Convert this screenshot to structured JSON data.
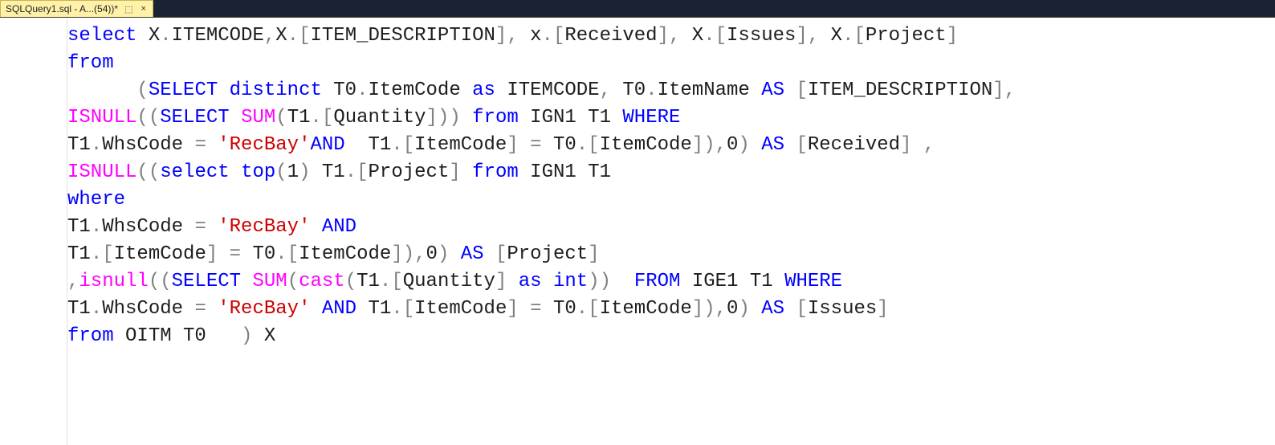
{
  "tab": {
    "title": "SQLQuery1.sql - A...(54))*",
    "pin_glyph": "⬚",
    "close_glyph": "×"
  },
  "code": {
    "tokens": [
      [
        [
          "kw",
          "select"
        ],
        [
          "id",
          " X"
        ],
        [
          "op",
          "."
        ],
        [
          "id",
          "ITEMCODE"
        ],
        [
          "op",
          ","
        ],
        [
          "id",
          "X"
        ],
        [
          "op",
          "."
        ],
        [
          "op",
          "["
        ],
        [
          "id",
          "ITEM_DESCRIPTION"
        ],
        [
          "op",
          "]"
        ],
        [
          "op",
          ","
        ],
        [
          "id",
          " x"
        ],
        [
          "op",
          "."
        ],
        [
          "op",
          "["
        ],
        [
          "id",
          "Received"
        ],
        [
          "op",
          "]"
        ],
        [
          "op",
          ","
        ],
        [
          "id",
          " X"
        ],
        [
          "op",
          "."
        ],
        [
          "op",
          "["
        ],
        [
          "id",
          "Issues"
        ],
        [
          "op",
          "]"
        ],
        [
          "op",
          ","
        ],
        [
          "id",
          " X"
        ],
        [
          "op",
          "."
        ],
        [
          "op",
          "["
        ],
        [
          "id",
          "Project"
        ],
        [
          "op",
          "]"
        ]
      ],
      [
        [
          "kw",
          "from"
        ]
      ],
      [
        [
          "id",
          "      "
        ],
        [
          "op",
          "("
        ],
        [
          "kw",
          "SELECT"
        ],
        [
          "id",
          " "
        ],
        [
          "kw",
          "distinct"
        ],
        [
          "id",
          " T0"
        ],
        [
          "op",
          "."
        ],
        [
          "id",
          "ItemCode "
        ],
        [
          "kw",
          "as"
        ],
        [
          "id",
          " ITEMCODE"
        ],
        [
          "op",
          ","
        ],
        [
          "id",
          " T0"
        ],
        [
          "op",
          "."
        ],
        [
          "id",
          "ItemName "
        ],
        [
          "kw",
          "AS"
        ],
        [
          "id",
          " "
        ],
        [
          "op",
          "["
        ],
        [
          "id",
          "ITEM_DESCRIPTION"
        ],
        [
          "op",
          "]"
        ],
        [
          "op",
          ","
        ]
      ],
      [
        [
          "fn",
          "ISNULL"
        ],
        [
          "op",
          "(("
        ],
        [
          "kw",
          "SELECT"
        ],
        [
          "id",
          " "
        ],
        [
          "fn",
          "SUM"
        ],
        [
          "op",
          "("
        ],
        [
          "id",
          "T1"
        ],
        [
          "op",
          "."
        ],
        [
          "op",
          "["
        ],
        [
          "id",
          "Quantity"
        ],
        [
          "op",
          "]"
        ],
        [
          "op",
          ")) "
        ],
        [
          "kw",
          "from"
        ],
        [
          "id",
          " IGN1 T1 "
        ],
        [
          "kw",
          "WHERE"
        ]
      ],
      [
        [
          "id",
          "T1"
        ],
        [
          "op",
          "."
        ],
        [
          "id",
          "WhsCode "
        ],
        [
          "op",
          "="
        ],
        [
          "id",
          " "
        ],
        [
          "str",
          "'RecBay'"
        ],
        [
          "kw",
          "AND"
        ],
        [
          "id",
          "  T1"
        ],
        [
          "op",
          "."
        ],
        [
          "op",
          "["
        ],
        [
          "id",
          "ItemCode"
        ],
        [
          "op",
          "]"
        ],
        [
          "id",
          " "
        ],
        [
          "op",
          "="
        ],
        [
          "id",
          " T0"
        ],
        [
          "op",
          "."
        ],
        [
          "op",
          "["
        ],
        [
          "id",
          "ItemCode"
        ],
        [
          "op",
          "]"
        ],
        [
          "op",
          "),"
        ],
        [
          "id",
          "0"
        ],
        [
          "op",
          ")"
        ],
        [
          "id",
          " "
        ],
        [
          "kw",
          "AS"
        ],
        [
          "id",
          " "
        ],
        [
          "op",
          "["
        ],
        [
          "id",
          "Received"
        ],
        [
          "op",
          "]"
        ],
        [
          "id",
          " "
        ],
        [
          "op",
          ","
        ]
      ],
      [
        [
          "fn",
          "ISNULL"
        ],
        [
          "op",
          "(("
        ],
        [
          "kw",
          "select"
        ],
        [
          "id",
          " "
        ],
        [
          "kw",
          "top"
        ],
        [
          "op",
          "("
        ],
        [
          "id",
          "1"
        ],
        [
          "op",
          ")"
        ],
        [
          "id",
          " T1"
        ],
        [
          "op",
          "."
        ],
        [
          "op",
          "["
        ],
        [
          "id",
          "Project"
        ],
        [
          "op",
          "]"
        ],
        [
          "id",
          " "
        ],
        [
          "kw",
          "from"
        ],
        [
          "id",
          " IGN1 T1"
        ]
      ],
      [
        [
          "kw",
          "where"
        ]
      ],
      [
        [
          "id",
          "T1"
        ],
        [
          "op",
          "."
        ],
        [
          "id",
          "WhsCode "
        ],
        [
          "op",
          "="
        ],
        [
          "id",
          " "
        ],
        [
          "str",
          "'RecBay'"
        ],
        [
          "id",
          " "
        ],
        [
          "kw",
          "AND"
        ]
      ],
      [
        [
          "id",
          "T1"
        ],
        [
          "op",
          "."
        ],
        [
          "op",
          "["
        ],
        [
          "id",
          "ItemCode"
        ],
        [
          "op",
          "]"
        ],
        [
          "id",
          " "
        ],
        [
          "op",
          "="
        ],
        [
          "id",
          " T0"
        ],
        [
          "op",
          "."
        ],
        [
          "op",
          "["
        ],
        [
          "id",
          "ItemCode"
        ],
        [
          "op",
          "]"
        ],
        [
          "op",
          "),"
        ],
        [
          "id",
          "0"
        ],
        [
          "op",
          ")"
        ],
        [
          "id",
          " "
        ],
        [
          "kw",
          "AS"
        ],
        [
          "id",
          " "
        ],
        [
          "op",
          "["
        ],
        [
          "id",
          "Project"
        ],
        [
          "op",
          "]"
        ]
      ],
      [
        [
          "op",
          ","
        ],
        [
          "fn",
          "isnull"
        ],
        [
          "op",
          "(("
        ],
        [
          "kw",
          "SELECT"
        ],
        [
          "id",
          " "
        ],
        [
          "fn",
          "SUM"
        ],
        [
          "op",
          "("
        ],
        [
          "fn",
          "cast"
        ],
        [
          "op",
          "("
        ],
        [
          "id",
          "T1"
        ],
        [
          "op",
          "."
        ],
        [
          "op",
          "["
        ],
        [
          "id",
          "Quantity"
        ],
        [
          "op",
          "]"
        ],
        [
          "id",
          " "
        ],
        [
          "kw",
          "as"
        ],
        [
          "id",
          " "
        ],
        [
          "kw",
          "int"
        ],
        [
          "op",
          "))"
        ],
        [
          "id",
          "  "
        ],
        [
          "kw",
          "FROM"
        ],
        [
          "id",
          " IGE1 T1 "
        ],
        [
          "kw",
          "WHERE"
        ]
      ],
      [
        [
          "id",
          "T1"
        ],
        [
          "op",
          "."
        ],
        [
          "id",
          "WhsCode "
        ],
        [
          "op",
          "="
        ],
        [
          "id",
          " "
        ],
        [
          "str",
          "'RecBay'"
        ],
        [
          "id",
          " "
        ],
        [
          "kw",
          "AND"
        ],
        [
          "id",
          " T1"
        ],
        [
          "op",
          "."
        ],
        [
          "op",
          "["
        ],
        [
          "id",
          "ItemCode"
        ],
        [
          "op",
          "]"
        ],
        [
          "id",
          " "
        ],
        [
          "op",
          "="
        ],
        [
          "id",
          " T0"
        ],
        [
          "op",
          "."
        ],
        [
          "op",
          "["
        ],
        [
          "id",
          "ItemCode"
        ],
        [
          "op",
          "]"
        ],
        [
          "op",
          "),"
        ],
        [
          "id",
          "0"
        ],
        [
          "op",
          ")"
        ],
        [
          "id",
          " "
        ],
        [
          "kw",
          "AS"
        ],
        [
          "id",
          " "
        ],
        [
          "op",
          "["
        ],
        [
          "id",
          "Issues"
        ],
        [
          "op",
          "]"
        ]
      ],
      [
        [
          "kw",
          "from"
        ],
        [
          "id",
          " OITM T0   "
        ],
        [
          "op",
          ")"
        ],
        [
          "id",
          " X"
        ]
      ]
    ]
  }
}
